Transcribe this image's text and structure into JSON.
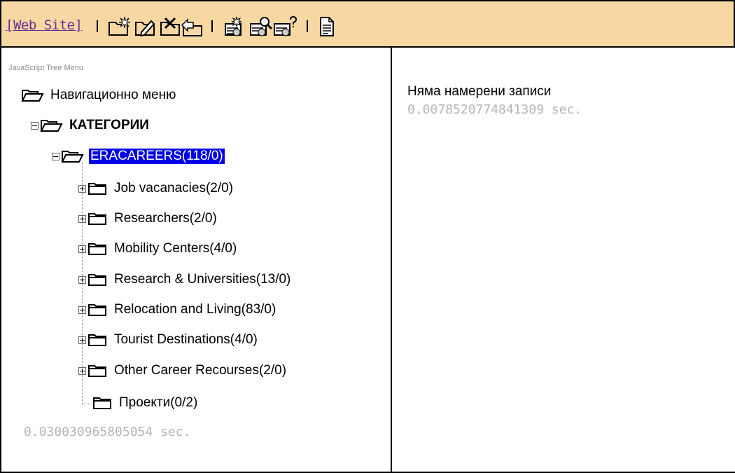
{
  "toolbar": {
    "web_site_link": "[Web Site]",
    "icons": [
      "new-folder-icon",
      "edit-folder-icon",
      "delete-folder-icon",
      "move-folder-icon",
      "new-record-icon",
      "search-record-icon",
      "help-record-icon",
      "document-icon"
    ]
  },
  "left": {
    "caption": "JavaScript Tree Menu",
    "root": "Навигационно меню",
    "categories": "КАТЕГОРИИ",
    "selected": "ERACAREERS(118/0)",
    "items": [
      {
        "label": "Job vacanacies(2/0)"
      },
      {
        "label": "Researchers(2/0)"
      },
      {
        "label": "Mobility Centers(4/0)"
      },
      {
        "label": "Research & Universities(13/0)"
      },
      {
        "label": "Relocation and Living(83/0)"
      },
      {
        "label": "Tourist Destinations(4/0)"
      },
      {
        "label": "Other Career Recourses(2/0)"
      }
    ],
    "last_item": "Проекти(0/2)",
    "timing": "0.030030965805054 sec."
  },
  "right": {
    "message": "Няма намерени записи",
    "timing": "0.0078520774841309 sec."
  },
  "colors": {
    "toolbar_bg": "#f7d8a3",
    "link": "#6b2c91",
    "selection": "#0000e6",
    "timing_text": "#b5b5b5"
  }
}
